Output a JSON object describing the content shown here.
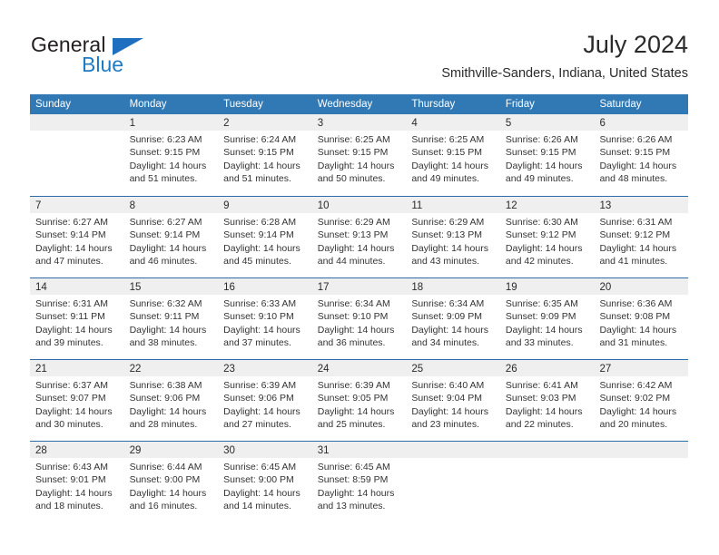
{
  "brand": {
    "name_dark": "General",
    "name_blue": "Blue",
    "triangle_icon": "triangle-icon",
    "accent_color": "#1f7ac4"
  },
  "header": {
    "title": "July 2024",
    "subtitle": "Smithville-Sanders, Indiana, United States"
  },
  "theme": {
    "header_blue": "#3079b5",
    "row_divider_blue": "#2d6ca8",
    "date_band_gray": "#efefef"
  },
  "calendar": {
    "weekday_headers": [
      "Sunday",
      "Monday",
      "Tuesday",
      "Wednesday",
      "Thursday",
      "Friday",
      "Saturday"
    ],
    "weeks": [
      [
        {
          "day": "",
          "lines": []
        },
        {
          "day": "1",
          "lines": [
            "Sunrise: 6:23 AM",
            "Sunset: 9:15 PM",
            "Daylight: 14 hours",
            "and 51 minutes."
          ]
        },
        {
          "day": "2",
          "lines": [
            "Sunrise: 6:24 AM",
            "Sunset: 9:15 PM",
            "Daylight: 14 hours",
            "and 51 minutes."
          ]
        },
        {
          "day": "3",
          "lines": [
            "Sunrise: 6:25 AM",
            "Sunset: 9:15 PM",
            "Daylight: 14 hours",
            "and 50 minutes."
          ]
        },
        {
          "day": "4",
          "lines": [
            "Sunrise: 6:25 AM",
            "Sunset: 9:15 PM",
            "Daylight: 14 hours",
            "and 49 minutes."
          ]
        },
        {
          "day": "5",
          "lines": [
            "Sunrise: 6:26 AM",
            "Sunset: 9:15 PM",
            "Daylight: 14 hours",
            "and 49 minutes."
          ]
        },
        {
          "day": "6",
          "lines": [
            "Sunrise: 6:26 AM",
            "Sunset: 9:15 PM",
            "Daylight: 14 hours",
            "and 48 minutes."
          ]
        }
      ],
      [
        {
          "day": "7",
          "lines": [
            "Sunrise: 6:27 AM",
            "Sunset: 9:14 PM",
            "Daylight: 14 hours",
            "and 47 minutes."
          ]
        },
        {
          "day": "8",
          "lines": [
            "Sunrise: 6:27 AM",
            "Sunset: 9:14 PM",
            "Daylight: 14 hours",
            "and 46 minutes."
          ]
        },
        {
          "day": "9",
          "lines": [
            "Sunrise: 6:28 AM",
            "Sunset: 9:14 PM",
            "Daylight: 14 hours",
            "and 45 minutes."
          ]
        },
        {
          "day": "10",
          "lines": [
            "Sunrise: 6:29 AM",
            "Sunset: 9:13 PM",
            "Daylight: 14 hours",
            "and 44 minutes."
          ]
        },
        {
          "day": "11",
          "lines": [
            "Sunrise: 6:29 AM",
            "Sunset: 9:13 PM",
            "Daylight: 14 hours",
            "and 43 minutes."
          ]
        },
        {
          "day": "12",
          "lines": [
            "Sunrise: 6:30 AM",
            "Sunset: 9:12 PM",
            "Daylight: 14 hours",
            "and 42 minutes."
          ]
        },
        {
          "day": "13",
          "lines": [
            "Sunrise: 6:31 AM",
            "Sunset: 9:12 PM",
            "Daylight: 14 hours",
            "and 41 minutes."
          ]
        }
      ],
      [
        {
          "day": "14",
          "lines": [
            "Sunrise: 6:31 AM",
            "Sunset: 9:11 PM",
            "Daylight: 14 hours",
            "and 39 minutes."
          ]
        },
        {
          "day": "15",
          "lines": [
            "Sunrise: 6:32 AM",
            "Sunset: 9:11 PM",
            "Daylight: 14 hours",
            "and 38 minutes."
          ]
        },
        {
          "day": "16",
          "lines": [
            "Sunrise: 6:33 AM",
            "Sunset: 9:10 PM",
            "Daylight: 14 hours",
            "and 37 minutes."
          ]
        },
        {
          "day": "17",
          "lines": [
            "Sunrise: 6:34 AM",
            "Sunset: 9:10 PM",
            "Daylight: 14 hours",
            "and 36 minutes."
          ]
        },
        {
          "day": "18",
          "lines": [
            "Sunrise: 6:34 AM",
            "Sunset: 9:09 PM",
            "Daylight: 14 hours",
            "and 34 minutes."
          ]
        },
        {
          "day": "19",
          "lines": [
            "Sunrise: 6:35 AM",
            "Sunset: 9:09 PM",
            "Daylight: 14 hours",
            "and 33 minutes."
          ]
        },
        {
          "day": "20",
          "lines": [
            "Sunrise: 6:36 AM",
            "Sunset: 9:08 PM",
            "Daylight: 14 hours",
            "and 31 minutes."
          ]
        }
      ],
      [
        {
          "day": "21",
          "lines": [
            "Sunrise: 6:37 AM",
            "Sunset: 9:07 PM",
            "Daylight: 14 hours",
            "and 30 minutes."
          ]
        },
        {
          "day": "22",
          "lines": [
            "Sunrise: 6:38 AM",
            "Sunset: 9:06 PM",
            "Daylight: 14 hours",
            "and 28 minutes."
          ]
        },
        {
          "day": "23",
          "lines": [
            "Sunrise: 6:39 AM",
            "Sunset: 9:06 PM",
            "Daylight: 14 hours",
            "and 27 minutes."
          ]
        },
        {
          "day": "24",
          "lines": [
            "Sunrise: 6:39 AM",
            "Sunset: 9:05 PM",
            "Daylight: 14 hours",
            "and 25 minutes."
          ]
        },
        {
          "day": "25",
          "lines": [
            "Sunrise: 6:40 AM",
            "Sunset: 9:04 PM",
            "Daylight: 14 hours",
            "and 23 minutes."
          ]
        },
        {
          "day": "26",
          "lines": [
            "Sunrise: 6:41 AM",
            "Sunset: 9:03 PM",
            "Daylight: 14 hours",
            "and 22 minutes."
          ]
        },
        {
          "day": "27",
          "lines": [
            "Sunrise: 6:42 AM",
            "Sunset: 9:02 PM",
            "Daylight: 14 hours",
            "and 20 minutes."
          ]
        }
      ],
      [
        {
          "day": "28",
          "lines": [
            "Sunrise: 6:43 AM",
            "Sunset: 9:01 PM",
            "Daylight: 14 hours",
            "and 18 minutes."
          ]
        },
        {
          "day": "29",
          "lines": [
            "Sunrise: 6:44 AM",
            "Sunset: 9:00 PM",
            "Daylight: 14 hours",
            "and 16 minutes."
          ]
        },
        {
          "day": "30",
          "lines": [
            "Sunrise: 6:45 AM",
            "Sunset: 9:00 PM",
            "Daylight: 14 hours",
            "and 14 minutes."
          ]
        },
        {
          "day": "31",
          "lines": [
            "Sunrise: 6:45 AM",
            "Sunset: 8:59 PM",
            "Daylight: 14 hours",
            "and 13 minutes."
          ]
        },
        {
          "day": "",
          "lines": []
        },
        {
          "day": "",
          "lines": []
        },
        {
          "day": "",
          "lines": []
        }
      ]
    ]
  }
}
